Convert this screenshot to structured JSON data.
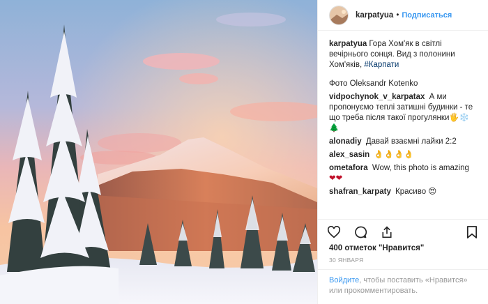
{
  "header": {
    "username": "karpatyua",
    "separator": "•",
    "follow_label": "Подписаться"
  },
  "caption": {
    "username": "karpatyua",
    "text": "Гора Хом'як в світлі вечірнього сонця. Вид з полонини Хом'яків, ",
    "hashtag": "#Карпати",
    "credit": "Фото Oleksandr Kotenko"
  },
  "comments": [
    {
      "username": "vidpochynok_v_karpatax",
      "text": "А ми пропонуємо теплі затишні будинки - те що треба після такої прогулянки🖐❄️🌲"
    },
    {
      "username": "alonadiy",
      "text": "Давай взаємні лайки 2:2"
    },
    {
      "username": "alex_sasin",
      "text": "👌👌👌👌"
    },
    {
      "username": "ometafora",
      "text": "Wow, this photo is amazing ",
      "emoji": "❤❤"
    },
    {
      "username": "shafran_karpaty",
      "text": "Красиво 😍"
    }
  ],
  "actions": {
    "like_icon": "heart-outline-icon",
    "comment_icon": "comment-icon",
    "share_icon": "share-icon",
    "save_icon": "bookmark-icon"
  },
  "likes_text": "400 отметок \"Нравится\"",
  "date_text": "30 января",
  "login": {
    "link_text": "Войдите",
    "rest_text": ", чтобы поставить «Нравится» или прокомментировать."
  },
  "colors": {
    "link_blue": "#3897f0",
    "hashtag": "#003569",
    "muted": "#999999",
    "heart_red": "#c0102a"
  }
}
